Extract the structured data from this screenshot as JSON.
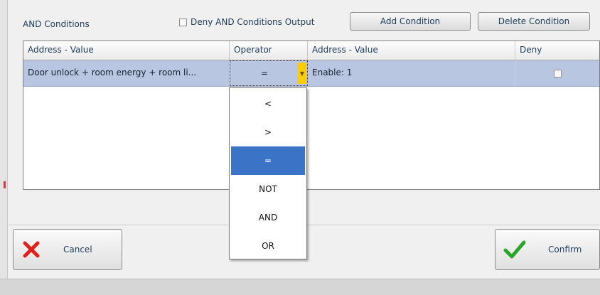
{
  "toolbar": {
    "title": "AND Conditions",
    "deny_output_label": "Deny AND Conditions Output",
    "deny_output_checked": false,
    "add_condition": "Add Condition",
    "delete_condition": "Delete Condition"
  },
  "grid": {
    "columns": [
      "Address - Value",
      "Operator",
      "Address - Value",
      "Deny"
    ],
    "rows": [
      {
        "address_left": "Door unlock + room energy + room li...",
        "operator": "=",
        "address_right": "Enable: 1",
        "deny": false
      }
    ]
  },
  "operator_dropdown": {
    "options": [
      "<",
      ">",
      "=",
      "NOT",
      "AND",
      "OR"
    ],
    "selected": "="
  },
  "footer": {
    "cancel": "Cancel",
    "confirm": "Confirm"
  },
  "colors": {
    "selection": "#3b73c7",
    "row_highlight": "#b8c6e2",
    "dropdown_arrow": "#ffcc00",
    "cancel_icon": "#e0201b",
    "confirm_icon": "#2aa52a"
  },
  "icons": [
    "close-icon",
    "checkmark-icon",
    "chevron-down-icon"
  ]
}
